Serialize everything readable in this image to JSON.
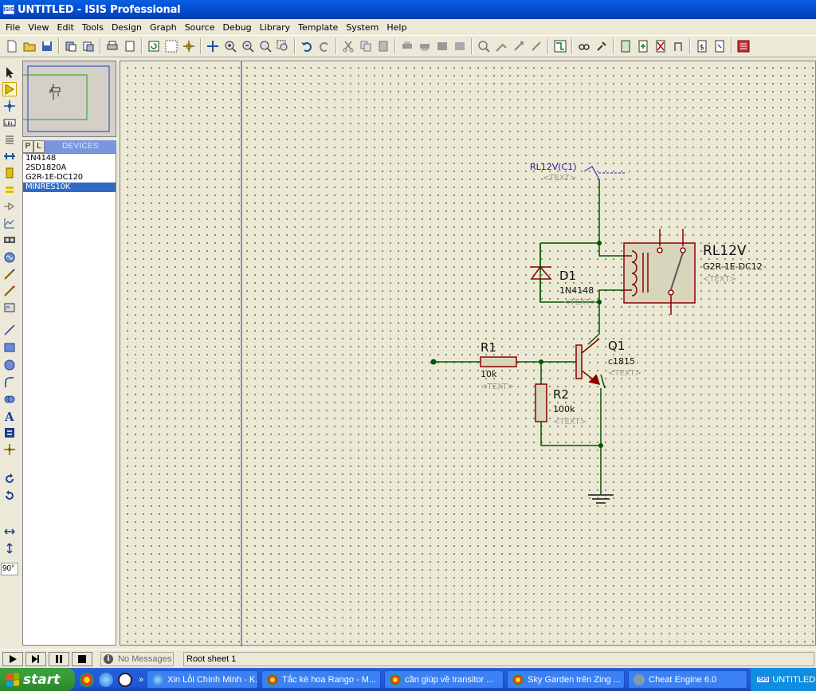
{
  "window": {
    "title": "UNTITLED - ISIS Professional",
    "icon_label": "ISIS"
  },
  "menu": [
    "File",
    "View",
    "Edit",
    "Tools",
    "Design",
    "Graph",
    "Source",
    "Debug",
    "Library",
    "Template",
    "System",
    "Help"
  ],
  "device_selector": {
    "tab_p": "P",
    "tab_l": "L",
    "title": "DEVICES",
    "items": [
      "1N4148",
      "2SD1820A",
      "G2R-1E-DC120",
      "MINRES10K"
    ],
    "selected_index": 3
  },
  "left_toolbar": {
    "rotation_value": "90°"
  },
  "schematic": {
    "terminal": {
      "label": "RL12V(C1)",
      "text": "<TEXT>"
    },
    "relay": {
      "ref": "RL12V",
      "value": "G2R-1E-DC12",
      "text": "<TEXT>"
    },
    "diode": {
      "ref": "D1",
      "value": "1N4148",
      "text": "<TEXT>"
    },
    "r1": {
      "ref": "R1",
      "value": "10k",
      "text": "<TEXT>"
    },
    "r2": {
      "ref": "R2",
      "value": "100k",
      "text": "<TEXT>"
    },
    "q1": {
      "ref": "Q1",
      "value": "c1815",
      "text": "<TEXT>"
    }
  },
  "status": {
    "messages": "No Messages",
    "sheet": "Root sheet 1"
  },
  "taskbar": {
    "start_label": "start",
    "tasks": [
      "Xin Lỗi Chính Minh - K...",
      "Tắc kè hoa Rango - M...",
      "cần giúp về transitor ...",
      "Sky Garden trên Zing ...",
      "Cheat Engine 6.0"
    ],
    "active_app": "UNTITLED"
  },
  "colors": {
    "wire": "#005500",
    "component": "#8b0000",
    "text_label": "#000000",
    "hidden_text": "#9a9a9a",
    "terminal": "#1a1aa8",
    "canvas": "#ebe9d4"
  }
}
